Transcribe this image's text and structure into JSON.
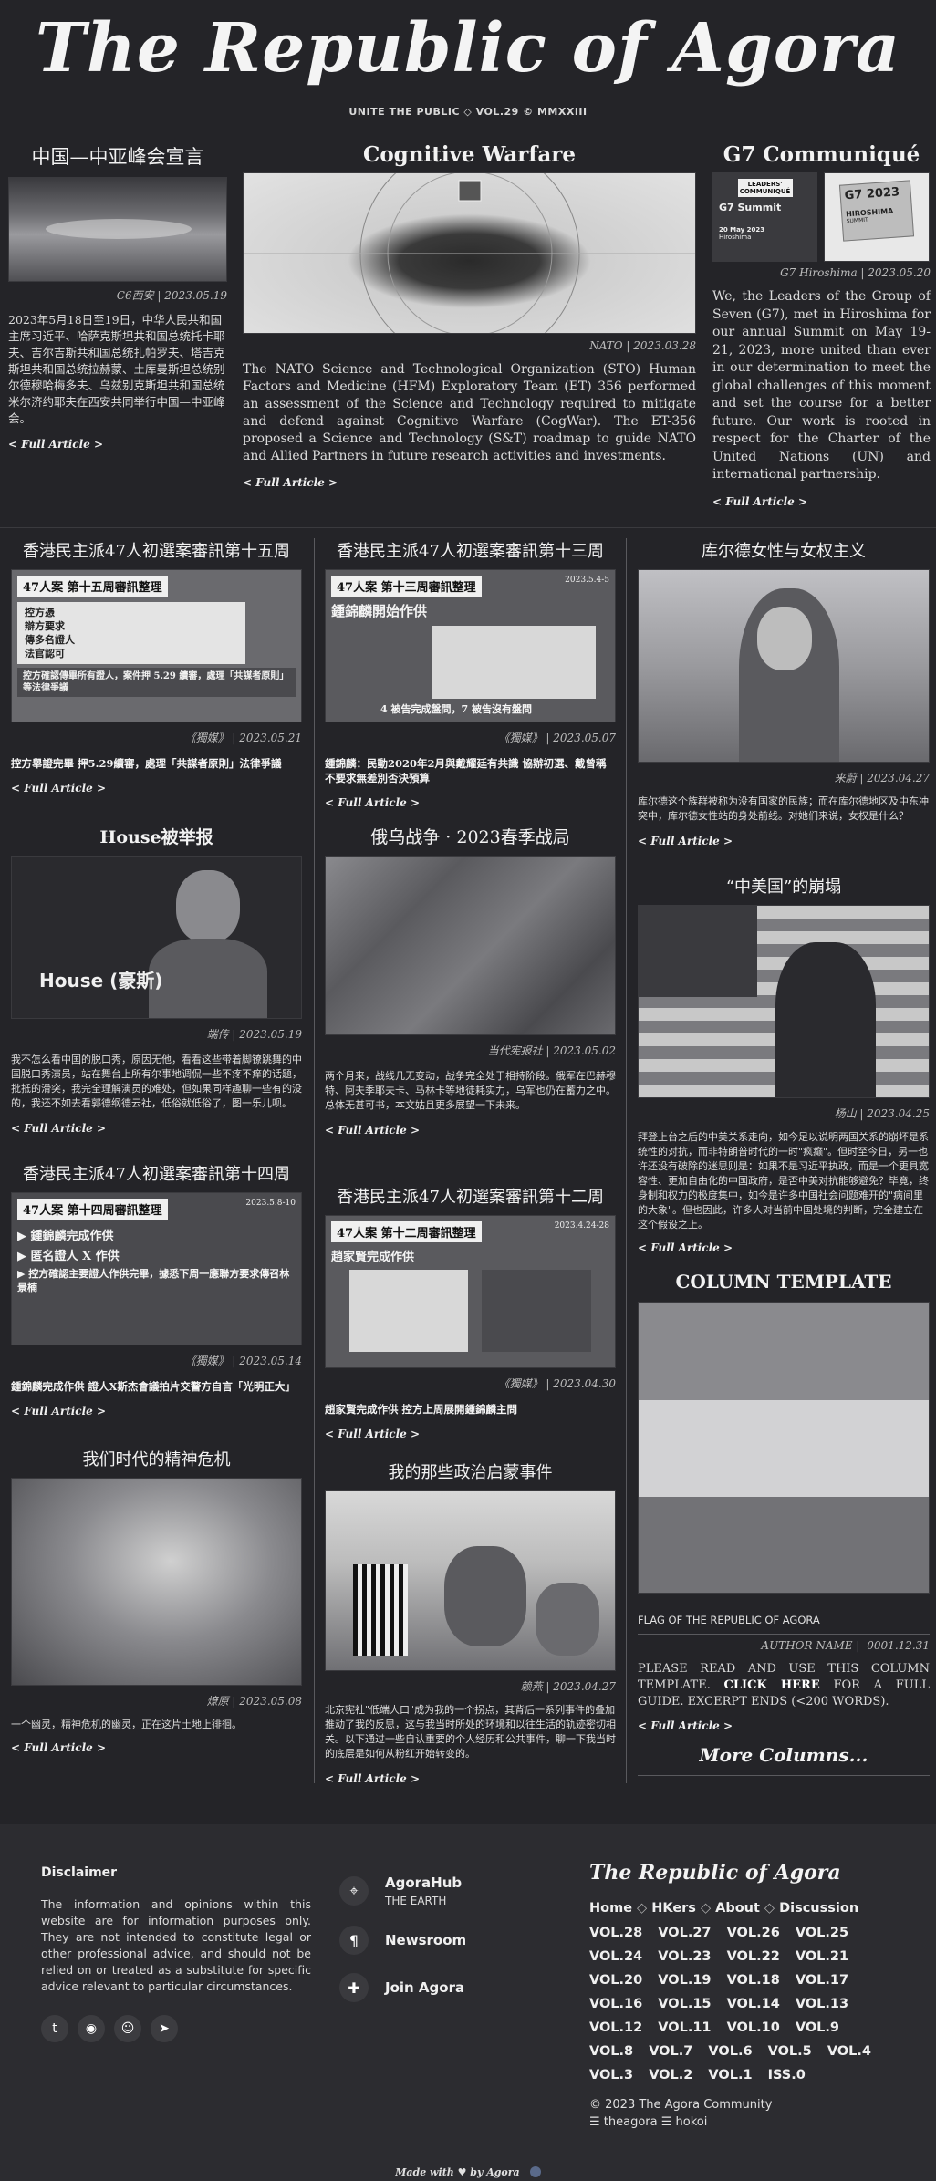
{
  "masthead": {
    "title": "The Republic of Agora",
    "tagline": "UNITE THE PUBLIC ◇ VOL.29 © MMXXIII"
  },
  "top": {
    "left": {
      "title": "中国—中亚峰会宣言",
      "credit": "C6西安 | 2023.05.19",
      "text": "2023年5月18日至19日，中华人民共和国主席习近平、哈萨克斯坦共和国总统托卡耶夫、吉尔吉斯共和国总统扎帕罗夫、塔吉克斯坦共和国总统拉赫蒙、土库曼斯坦总统别尔德穆哈梅多夫、乌兹别克斯坦共和国总统米尔济约耶夫在西安共同举行中国—中亚峰会。",
      "full": "< Full Article >"
    },
    "center": {
      "title": "Cognitive Warfare",
      "credit": "NATO | 2023.03.28",
      "text": "The NATO Science and Technological Organization (STO) Human Factors and Medicine (HFM) Exploratory Team (ET) 356 performed an assessment of the Science and Technology required to mitigate and defend against Cognitive Warfare (CogWar). The ET-356 proposed a Science and Technology (S&T) roadmap to guide NATO and Allied Partners in future research activities and investments.",
      "full": "< Full Article >"
    },
    "right": {
      "title": "G7 Communiqué",
      "img_a_label": "LEADERS' COMMUNIQUÉ",
      "img_a_title": "G7 Summit",
      "img_a_date": "20 May 2023",
      "img_a_place": "Hiroshima",
      "img_b_label": "G7 2023",
      "img_b_title": "HIROSHIMA",
      "img_b_sub": "SUMMIT",
      "credit": "G7 Hiroshima | 2023.05.20",
      "text": "We, the Leaders of the Group of Seven (G7), met in Hiroshima for our annual Summit on May 19-21, 2023, more united than ever in our determination to meet the global challenges of this moment and set the course for a better future. Our work is rooted in respect for the Charter of the United Nations (UN) and international partnership.",
      "full": "< Full Article >"
    }
  },
  "col1": [
    {
      "title": "香港民主派47人初選案審訊第十五周",
      "img_heading": "47人案 第十五周審訊整理",
      "img_lines": [
        "控方憑",
        "辯方要求",
        "傳多名證人",
        "法官認可",
        "控方確認傳畢所有證人，案件押 5.29 續審，處理「共謀者原則」等法律爭議"
      ],
      "credit": "《獨媒》 | 2023.05.21",
      "text": "控方舉證完畢 押5.29續審，處理「共謀者原則」法律爭議",
      "full": "< Full Article >"
    },
    {
      "title": "House被举报",
      "img_caption": "House (豪斯)",
      "credit": "端传 | 2023.05.19",
      "text": "我不怎么看中国的脱口秀，原因无他，看看这些带着脚镣跳舞的中国脱口秀演员，站在舞台上所有尔事地调侃一些不疼不痒的话题，批抵的滑突，我完全理解演员的难处，但如果同样趣聊一些有的没的，我还不如去看郭德纲德云社，低俗就低俗了，图一乐儿呗。",
      "full": "< Full Article >"
    },
    {
      "title": "香港民主派47人初選案審訊第十四周",
      "img_heading": "47人案 第十四周審訊整理",
      "img_lines": [
        "▶ 鍾錦麟完成作供",
        "▶ 匿名證人 X 作供",
        "▶ 控方確認主要證人作供完畢，據悉下周一應聯方要求傳召林景楠"
      ],
      "img_date": "2023.5.8-10",
      "credit": "《獨媒》 | 2023.05.14",
      "text": "鍾錦麟完成作供 證人X斯杰會議拍片交警方自言「光明正大」",
      "full": "< Full Article >"
    },
    {
      "title": "我们时代的精神危机",
      "credit": "燎原 | 2023.05.08",
      "text": "一个幽灵，精神危机的幽灵，正在这片土地上徘徊。",
      "full": "< Full Article >"
    }
  ],
  "col2": [
    {
      "title": "香港民主派47人初選案審訊第十三周",
      "img_heading": "47人案 第十三周審訊整理",
      "img_sub": "鍾錦麟開始作供",
      "img_date": "2023.5.4-5",
      "img_footer": "4 被告完成盤問，7 被告沒有盤問",
      "credit": "《獨媒》 | 2023.05.07",
      "text": "鍾錦麟：民動2020年2月與戴耀廷有共識 協辦初選、戴曾稱不要求無差別否決預算",
      "full": "< Full Article >"
    },
    {
      "title": "俄乌战争 · 2023春季战局",
      "credit": "当代宪报社 | 2023.05.02",
      "text": "两个月来，战线几无变动，战争完全处于相持阶段。俄军在巴赫穆特、阿夫季耶夫卡、马林卡等地徒耗实力，乌军也仍在蓄力之中。总体无甚可书，本文姑且更多展望一下未来。",
      "full": "< Full Article >"
    },
    {
      "title": "香港民主派47人初選案審訊第十二周",
      "img_heading": "47人案 第十二周審訊整理",
      "img_sub": "趙家賢完成作供",
      "img_date": "2023.4.24-28",
      "credit": "《獨媒》 | 2023.04.30",
      "text": "趙家賢完成作供 控方上周展開鍾錦麟主問",
      "full": "< Full Article >"
    },
    {
      "title": "我的那些政治启蒙事件",
      "credit": "赖燕 | 2023.04.27",
      "text": "北京宪社\"低端人口\"成为我的一个拐点，其背后一系列事件的叠加推动了我的反思，这与我当时所处的环境和以往生活的轨迹密切相关。以下通过一些自认重要的个人经历和公共事件，聊一下我当时的底层是如何从粉红开始转变的。",
      "full": "< Full Article >"
    }
  ],
  "col3": [
    {
      "title": "库尔德女性与女权主义",
      "credit": "来蔚 | 2023.04.27",
      "text": "库尔德这个族群被称为没有国家的民族；而在库尔德地区及中东冲突中，库尔德女性站的身处前线。对她们来说，女权是什么？",
      "full": "< Full Article >"
    },
    {
      "title": "“中美国”的崩塌",
      "credit": "杨山 | 2023.04.25",
      "text": "拜登上台之后的中美关系走向，如今足以说明两国关系的崩坏是系统性的对抗，而非特朗普时代的一时\"疯癫\"。但时至今日，另一也许还没有破除的迷思则是：如果不是习近平执政，而是一个更具宽容性、更加自由化的中国政府，是否中美对抗能够避免？毕竟，终身制和权力的极度集中，如今是许多中国社会问题难开的\"病间里的大象\"。但也因此，许多人对当前中国处境的判断，完全建立在这个假设之上。",
      "full": "< Full Article >"
    },
    {
      "title": "COLUMN TEMPLATE",
      "flag_caption": "FLAG OF THE REPUBLIC OF AGORA",
      "credit": "AUTHOR NAME | -0001.12.31",
      "text_a": "PLEASE READ AND USE THIS COLUMN TEMPLATE.",
      "text_link": "CLICK HERE",
      "text_b": "FOR A FULL GUIDE. EXCERPT ENDS (<200 WORDS).",
      "full": "< Full Article >",
      "more": "More Columns..."
    }
  ],
  "footer": {
    "disclaimer_title": "Disclaimer",
    "disclaimer_text": "The information and opinions within this website are for information purposes only. They are not intended to constitute legal or other professional advice, and should not be relied on or treated as a substitute for specific advice relevant to particular circumstances.",
    "links": [
      {
        "icon": "map-pin-icon",
        "title": "AgoraHub",
        "sub": "THE EARTH"
      },
      {
        "icon": "paragraph-icon",
        "title": "Newsroom",
        "sub": ""
      },
      {
        "icon": "puzzle-icon",
        "title": "Join Agora",
        "sub": ""
      }
    ],
    "brand": "The Republic of Agora",
    "nav": [
      "Home",
      "HKers",
      "About",
      "Discussion"
    ],
    "volumes": [
      "VOL.28",
      "VOL.27",
      "VOL.26",
      "VOL.25",
      "VOL.24",
      "VOL.23",
      "VOL.22",
      "VOL.21",
      "VOL.20",
      "VOL.19",
      "VOL.18",
      "VOL.17",
      "VOL.16",
      "VOL.15",
      "VOL.14",
      "VOL.13",
      "VOL.12",
      "VOL.11",
      "VOL.10",
      "VOL.9",
      "VOL.8",
      "VOL.7",
      "VOL.6",
      "VOL.5",
      "VOL.4",
      "VOL.3",
      "VOL.2",
      "VOL.1",
      "ISS.0"
    ],
    "copyright": "© 2023 The Agora Community",
    "credits": "☰ theagora ☰ hokoi",
    "made_with": "Made with ♥ by Agora",
    "social": [
      "twitter-icon",
      "github-icon",
      "reddit-icon",
      "telegram-icon"
    ]
  }
}
